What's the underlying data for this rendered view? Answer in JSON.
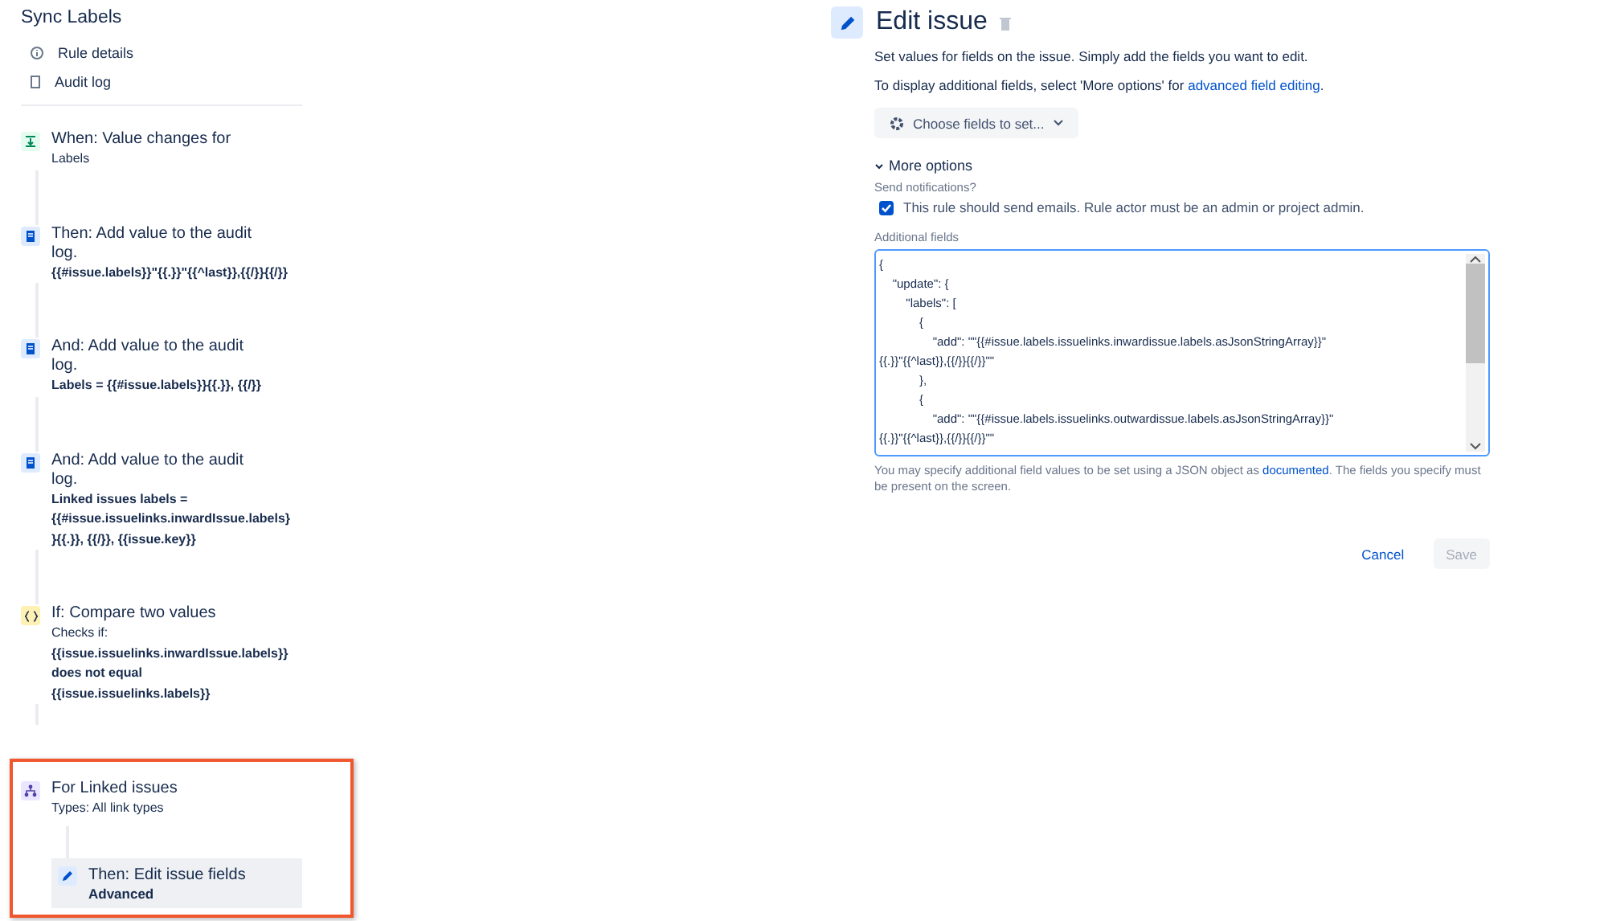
{
  "rule": {
    "title": "Sync Labels",
    "nav": [
      {
        "kind": "info",
        "label": "Rule details"
      },
      {
        "kind": "log",
        "label": "Audit log"
      }
    ],
    "steps": [
      {
        "kind": "trigger",
        "title": "When: Value changes for",
        "lines": [
          {
            "text": "Labels",
            "bold": false
          }
        ],
        "highlighted": false
      },
      {
        "kind": "log",
        "title": "Then: Add value to the audit log.",
        "lines": [
          {
            "text": "{{#issue.labels}}\"{{.}}\"{{^last}},{{/}}{{/}}",
            "bold": true
          }
        ],
        "highlighted": false
      },
      {
        "kind": "log",
        "title": "And: Add value to the audit log.",
        "lines": [
          {
            "text": "Labels = {{#issue.labels}}{{.}}, {{/}}",
            "bold": true
          }
        ],
        "highlighted": false
      },
      {
        "kind": "log",
        "title": "And: Add value to the audit log.",
        "lines": [
          {
            "text": "Linked issues labels =",
            "bold": true
          },
          {
            "text": "{{#issue.issuelinks.inwardIssue.labels}",
            "bold": true
          },
          {
            "text": "}{{.}}, {{/}}, {{issue.key}}",
            "bold": true
          }
        ],
        "highlighted": false
      },
      {
        "kind": "condition",
        "title": "If: Compare two values",
        "lines": [
          {
            "text": "Checks if:",
            "bold": false
          },
          {
            "text": "{{issue.issuelinks.inwardIssue.labels}}",
            "bold": true
          },
          {
            "text": "does not equal",
            "bold": true
          },
          {
            "text": "{{issue.issuelinks.labels}}",
            "bold": true
          }
        ],
        "highlighted": false
      },
      {
        "kind": "branch",
        "title": "For Linked issues",
        "lines": [
          {
            "text": "Types: All link types",
            "bold": false
          }
        ],
        "highlighted": true,
        "children": [
          {
            "kind": "action",
            "title": "Then: Edit issue fields",
            "subtitle": "Advanced",
            "selected": true
          }
        ]
      }
    ]
  },
  "editor": {
    "title": "Edit issue",
    "intro": "Set values for fields on the issue. Simply add the fields you want to edit.",
    "hint": "To display additional fields, select 'More options' for",
    "hint_link": "advanced field editing",
    "hint_end": ".",
    "choose_button": "Choose fields to set...",
    "more_options": {
      "label": "More options",
      "expanded": true
    },
    "notifications": {
      "label": "Send notifications?",
      "checkbox": "This rule should send emails. Rule actor must be an admin or project admin.",
      "checked": true
    },
    "additional": {
      "label": "Additional fields",
      "value": "{\n\t\"update\": {\n\t\t\"labels\": [\n\t\t\t{\n\t\t\t\t\"add\": \"\"{{#issue.labels.issuelinks.inwardissue.labels.asJsonStringArray}}\"\n{{.}}\"{{^last}},{{/}}{{/}}\"\"\n\t\t\t},\n\t\t\t{\n\t\t\t\t\"add\": \"\"{{#issue.labels.issuelinks.outwardissue.labels.asJsonStringArray}}\"\n{{.}}\"{{^last}},{{/}}{{/}}\"\"",
      "help": "You may specify additional field values to be set using a JSON object as",
      "help_link": "documented",
      "help_end": ". The fields you specify must be present on the screen."
    },
    "buttons": [
      {
        "kind": "link",
        "label": "Cancel",
        "disabled": false
      },
      {
        "kind": "primary",
        "label": "Save",
        "disabled": true
      }
    ]
  }
}
